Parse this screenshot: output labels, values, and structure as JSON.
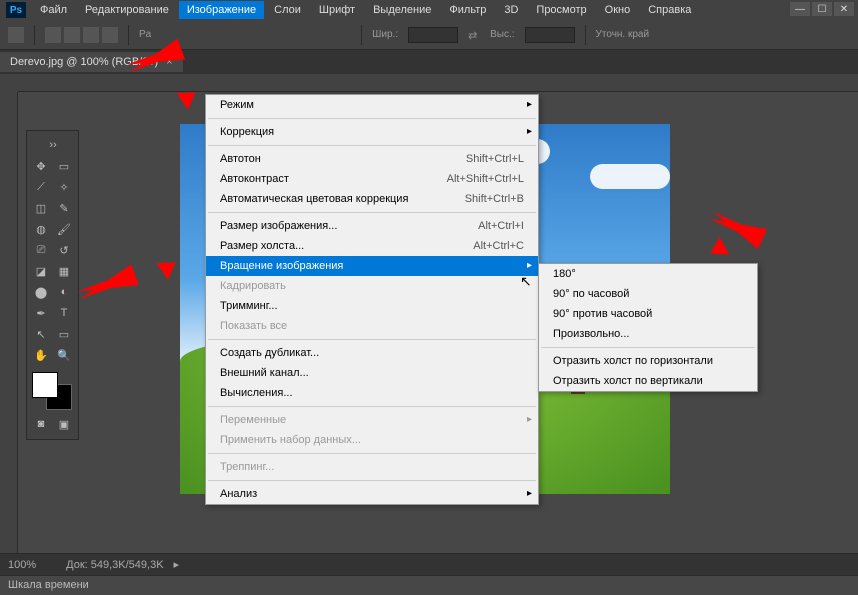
{
  "app_logo": "Ps",
  "menus": [
    "Файл",
    "Редактирование",
    "Изображение",
    "Слои",
    "Шрифт",
    "Выделение",
    "Фильтр",
    "3D",
    "Просмотр",
    "Окно",
    "Справка"
  ],
  "active_menu_index": 2,
  "options_bar": {
    "pa_label": "Pa",
    "width_label": "Шир.:",
    "height_label": "Выс.:",
    "edge_label": "Уточн. край"
  },
  "doc_tab": "Derevo.jpg @ 100% (RGB/8#)",
  "dropdown_main": [
    {
      "label": "Режим",
      "type": "sub"
    },
    {
      "type": "sep"
    },
    {
      "label": "Коррекция",
      "type": "sub"
    },
    {
      "type": "sep"
    },
    {
      "label": "Автотон",
      "shortcut": "Shift+Ctrl+L"
    },
    {
      "label": "Автоконтраст",
      "shortcut": "Alt+Shift+Ctrl+L"
    },
    {
      "label": "Автоматическая цветовая коррекция",
      "shortcut": "Shift+Ctrl+B"
    },
    {
      "type": "sep"
    },
    {
      "label": "Размер изображения...",
      "shortcut": "Alt+Ctrl+I"
    },
    {
      "label": "Размер холста...",
      "shortcut": "Alt+Ctrl+C"
    },
    {
      "label": "Вращение изображения",
      "type": "sub",
      "highlighted": true
    },
    {
      "label": "Кадрировать",
      "disabled": true
    },
    {
      "label": "Тримминг..."
    },
    {
      "label": "Показать все",
      "disabled": true
    },
    {
      "type": "sep"
    },
    {
      "label": "Создать дубликат..."
    },
    {
      "label": "Внешний канал..."
    },
    {
      "label": "Вычисления..."
    },
    {
      "type": "sep"
    },
    {
      "label": "Переменные",
      "type": "sub",
      "disabled": true
    },
    {
      "label": "Применить набор данных...",
      "disabled": true
    },
    {
      "type": "sep"
    },
    {
      "label": "Треппинг...",
      "disabled": true
    },
    {
      "type": "sep"
    },
    {
      "label": "Анализ",
      "type": "sub"
    }
  ],
  "dropdown_sub": [
    {
      "label": "180°"
    },
    {
      "label": "90° по часовой"
    },
    {
      "label": "90° против часовой"
    },
    {
      "label": "Произвольно..."
    },
    {
      "type": "sep"
    },
    {
      "label": "Отразить холст по горизонтали"
    },
    {
      "label": "Отразить холст по вертикали"
    }
  ],
  "status": {
    "zoom": "100%",
    "doc": "Док: 549,3K/549,3K"
  },
  "timeline": "Шкала времени"
}
